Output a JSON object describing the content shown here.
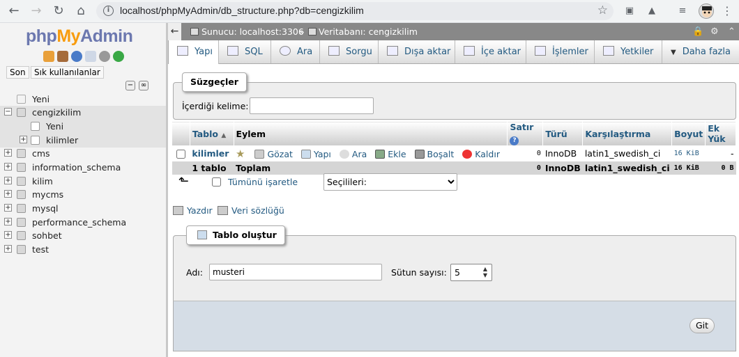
{
  "browser": {
    "url": "localhost/phpMyAdmin/db_structure.php?db=cengizkilim"
  },
  "logo": {
    "php": "php",
    "my": "My",
    "admin": "Admin"
  },
  "leftpanel": {
    "tabs": [
      "Son",
      "Sık kullanılanlar"
    ],
    "tree": [
      {
        "label": "Yeni",
        "level": 0,
        "type": "new"
      },
      {
        "label": "cengizkilim",
        "level": 0,
        "type": "db",
        "selected": true
      },
      {
        "label": "Yeni",
        "level": 1,
        "type": "new"
      },
      {
        "label": "kilimler",
        "level": 1,
        "type": "table"
      },
      {
        "label": "cms",
        "level": 0,
        "type": "db"
      },
      {
        "label": "information_schema",
        "level": 0,
        "type": "db"
      },
      {
        "label": "kilim",
        "level": 0,
        "type": "db"
      },
      {
        "label": "mycms",
        "level": 0,
        "type": "db"
      },
      {
        "label": "mysql",
        "level": 0,
        "type": "db"
      },
      {
        "label": "performance_schema",
        "level": 0,
        "type": "db"
      },
      {
        "label": "sohbet",
        "level": 0,
        "type": "db"
      },
      {
        "label": "test",
        "level": 0,
        "type": "db"
      }
    ]
  },
  "breadcrumb": {
    "server": "Sunucu: localhost:3306",
    "sep": "»",
    "database": "Veritabanı: cengizkilim"
  },
  "menu": {
    "tabs": [
      "Yapı",
      "SQL",
      "Ara",
      "Sorgu",
      "Dışa aktar",
      "İçe aktar",
      "İşlemler",
      "Yetkiler",
      "Daha fazla"
    ]
  },
  "filters": {
    "legend": "Süzgeçler",
    "label": "İçerdiği kelime:",
    "value": ""
  },
  "table": {
    "headers": {
      "name": "Tablo",
      "action": "Eylem",
      "rows": "Satır",
      "type": "Türü",
      "collation": "Karşılaştırma",
      "size": "Boyut",
      "overhead": "Ek Yük"
    },
    "row": {
      "name": "kilimler",
      "actions": [
        "Gözat",
        "Yapı",
        "Ara",
        "Ekle",
        "Boşalt",
        "Kaldır"
      ],
      "rows": "0",
      "type": "InnoDB",
      "collation": "latin1_swedish_ci",
      "size": "16 KiB",
      "overhead": "-"
    },
    "footer": {
      "name": "1 tablo",
      "action": "Toplam",
      "rows": "0",
      "type": "InnoDB",
      "collation": "latin1_swedish_ci",
      "size": "16 KiB",
      "overhead": "0 B"
    }
  },
  "bulk": {
    "check_all": "Tümünü işaretle",
    "with_selected": "Seçilileri:"
  },
  "links": {
    "print": "Yazdır",
    "dict": "Veri sözlüğü"
  },
  "create": {
    "legend": "Tablo oluştur",
    "name_label": "Adı:",
    "name_value": "musteri",
    "cols_label": "Sütun sayısı:",
    "cols_value": "5",
    "go": "Git"
  }
}
